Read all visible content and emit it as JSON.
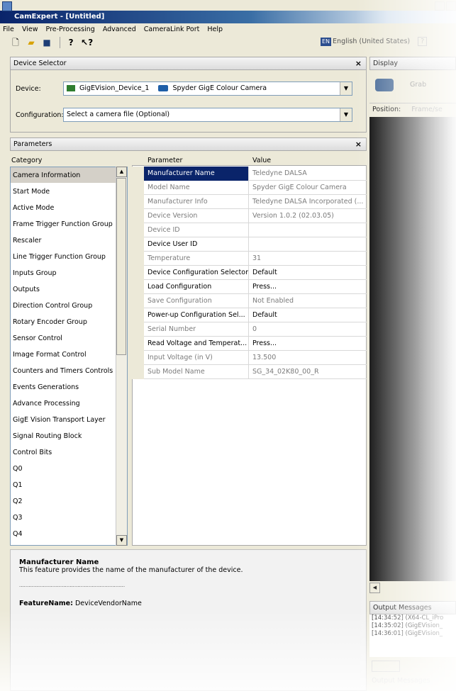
{
  "window": {
    "title": "CamExpert - [Untitled]"
  },
  "menu": [
    "File",
    "View",
    "Pre-Processing",
    "Advanced",
    "CameraLink Port",
    "Help"
  ],
  "toolbar": {
    "icons": [
      "new-file-icon",
      "open-folder-icon",
      "save-icon",
      "help-icon",
      "context-help-icon"
    ]
  },
  "language": {
    "badge": "EN",
    "label": "English (United States)",
    "help": "?"
  },
  "device_selector": {
    "title": "Device Selector",
    "close": "×",
    "device_label": "Device:",
    "device_value": "GigEVision_Device_1",
    "camera_value": "Spyder GigE Colour Camera",
    "config_label": "Configuration:",
    "config_value": "Select a camera file (Optional)"
  },
  "parameters": {
    "title": "Parameters",
    "close": "×",
    "category_header": "Category",
    "categories": [
      "Camera Information",
      "Start Mode",
      "Active Mode",
      "Frame Trigger Function Group",
      "Rescaler",
      "Line Trigger Function Group",
      "Inputs Group",
      "Outputs",
      "Direction Control Group",
      "Rotary Encoder Group",
      "Sensor Control",
      "Image Format Control",
      "Counters and Timers Controls",
      "Events Generations",
      "Advance Processing",
      "GigE Vision Transport Layer",
      "Signal Routing Block",
      "Control Bits",
      "Q0",
      "Q1",
      "Q2",
      "Q3",
      "Q4"
    ],
    "parameter_header": "Parameter",
    "value_header": "Value",
    "rows": [
      {
        "name": "Manufacturer Name",
        "value": "Teledyne DALSA"
      },
      {
        "name": "Model Name",
        "value": "Spyder GigE Colour Camera"
      },
      {
        "name": "Manufacturer Info",
        "value": "Teledyne  DALSA Incorporated (..."
      },
      {
        "name": "Device Version",
        "value": "Version 1.0.2  (02.03.05)"
      },
      {
        "name": "Device ID",
        "value": ""
      },
      {
        "name": "Device User ID",
        "value": ""
      },
      {
        "name": "Temperature",
        "value": "31"
      },
      {
        "name": "Device Configuration Selector",
        "value": "Default"
      },
      {
        "name": "Load Configuration",
        "value": "Press..."
      },
      {
        "name": "Save Configuration",
        "value": "Not Enabled"
      },
      {
        "name": "Power-up Configuration Sel...",
        "value": "Default"
      },
      {
        "name": "Serial Number",
        "value": "0"
      },
      {
        "name": "Read Voltage and Temperat...",
        "value": "Press..."
      },
      {
        "name": "Input Voltage (in V)",
        "value": "13.500"
      },
      {
        "name": "Sub Model Name",
        "value": "SG_34_02K80_00_R"
      }
    ]
  },
  "description": {
    "title": "Manufacturer Name",
    "text": "This feature provides the name of the manufacturer of the device.",
    "separator": "...................................................................",
    "feature_label": "FeatureName:",
    "feature_value": "DeviceVendorName"
  },
  "display": {
    "title": "Display",
    "grab": "Grab",
    "position_label": "Position:",
    "position_value": "Frame/se"
  },
  "output": {
    "title": "Output Messages",
    "lines": [
      "[14:34:52] (X64-CL_iPro",
      "[14:35:02] (GigEVision_",
      "[14:36:01] (GigEVision_"
    ],
    "tab": "Output Messages"
  }
}
